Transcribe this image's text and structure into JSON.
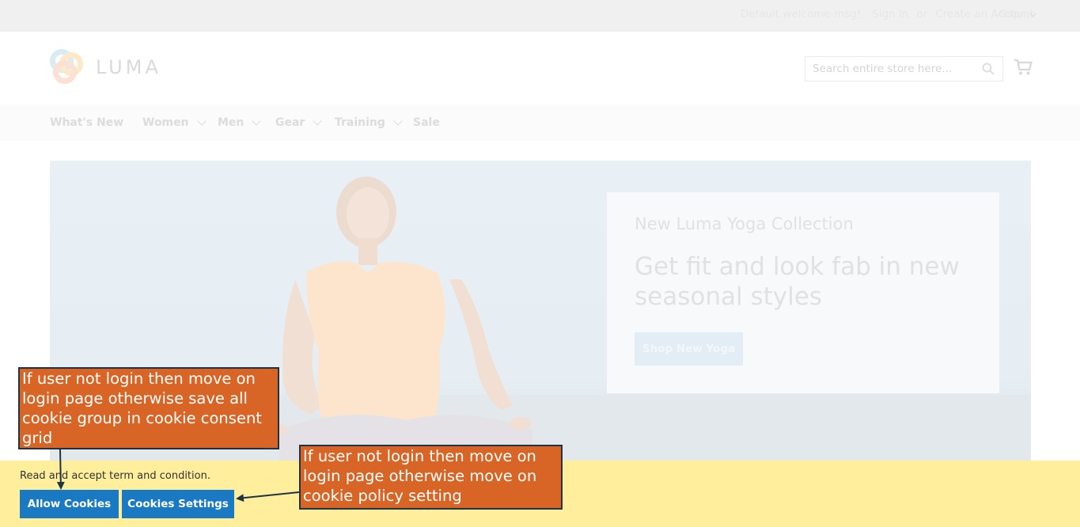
{
  "topbar": {
    "welcome": "Default welcome msg!",
    "sign_in": "Sign In",
    "or": "or",
    "create_account": "Create an Account",
    "gdpr": "Gdpr"
  },
  "header": {
    "logo_text": "LUMA",
    "search_placeholder": "Search entire store here...",
    "icons": {
      "search": "search-icon",
      "cart": "cart-icon"
    }
  },
  "nav": {
    "items": [
      {
        "label": "What's New",
        "has_submenu": false
      },
      {
        "label": "Women",
        "has_submenu": true
      },
      {
        "label": "Men",
        "has_submenu": true
      },
      {
        "label": "Gear",
        "has_submenu": true
      },
      {
        "label": "Training",
        "has_submenu": true
      },
      {
        "label": "Sale",
        "has_submenu": false
      }
    ]
  },
  "hero": {
    "subtitle": "New Luma Yoga Collection",
    "title": "Get fit and look fab in new seasonal styles",
    "button": "Shop New Yoga"
  },
  "cookie": {
    "text": "Read and accept term and condition.",
    "allow_button": "Allow Cookies",
    "settings_button": "Cookies Settings",
    "bar_color": "#ffee9c",
    "button_color": "#1979c3"
  },
  "annotations": {
    "allow_note": "If user not login then move on login page otherwise save all cookie group in cookie consent grid",
    "settings_note": "If user not login then move on login page otherwise move on cookie policy setting",
    "note_color": "#d86526"
  }
}
